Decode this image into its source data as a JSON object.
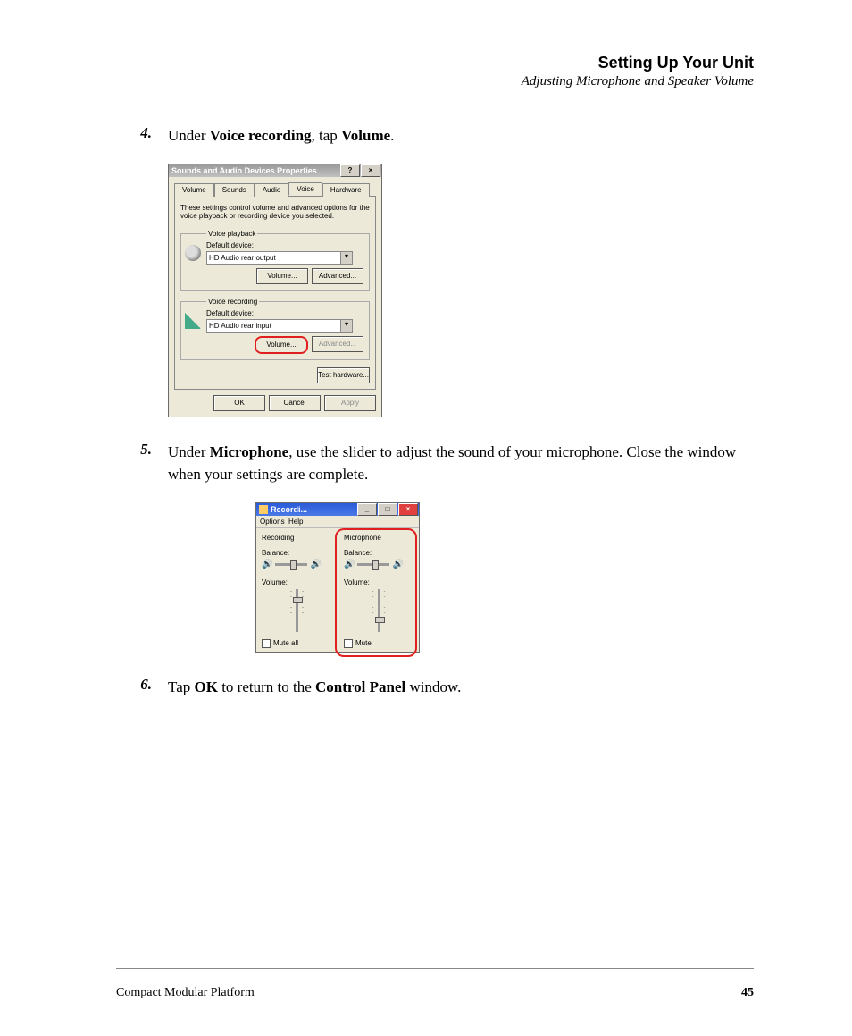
{
  "header": {
    "title": "Setting Up Your Unit",
    "subtitle": "Adjusting Microphone and Speaker Volume"
  },
  "steps": {
    "s4": {
      "num": "4.",
      "pre": "Under ",
      "b1": "Voice recording",
      "mid": ", tap ",
      "b2": "Volume",
      "post": "."
    },
    "s5": {
      "num": "5.",
      "pre": "Under ",
      "b1": "Microphone",
      "rest": ", use the slider to adjust the sound of your microphone. Close the window when your settings are complete."
    },
    "s6": {
      "num": "6.",
      "pre": "Tap ",
      "b1": "OK",
      "mid": " to return to the ",
      "b2": "Control Panel",
      "post": " window."
    }
  },
  "dlg1": {
    "title": "Sounds and Audio Devices Properties",
    "help": "?",
    "close": "×",
    "tabs": {
      "volume": "Volume",
      "sounds": "Sounds",
      "audio": "Audio",
      "voice": "Voice",
      "hardware": "Hardware"
    },
    "desc": "These settings control volume and advanced options for the voice playback or recording device you selected.",
    "playback": {
      "legend": "Voice playback",
      "label": "Default device:",
      "device": "HD Audio rear output",
      "volume": "Volume...",
      "advanced": "Advanced..."
    },
    "recording": {
      "legend": "Voice recording",
      "label": "Default device:",
      "device": "HD Audio rear input",
      "volume": "Volume...",
      "advanced": "Advanced..."
    },
    "testhw": "Test hardware...",
    "ok": "OK",
    "cancel": "Cancel",
    "apply": "Apply"
  },
  "dlg2": {
    "title": "Recordi...",
    "min": "_",
    "max": "□",
    "close": "×",
    "menu": {
      "options": "Options",
      "help": "Help"
    },
    "col_rec": {
      "title": "Recording",
      "balance": "Balance:",
      "volume": "Volume:",
      "muteall": "Mute all"
    },
    "col_mic": {
      "title": "Microphone",
      "balance": "Balance:",
      "volume": "Volume:",
      "mute": "Mute"
    }
  },
  "footer": {
    "left": "Compact Modular Platform",
    "page": "45"
  }
}
